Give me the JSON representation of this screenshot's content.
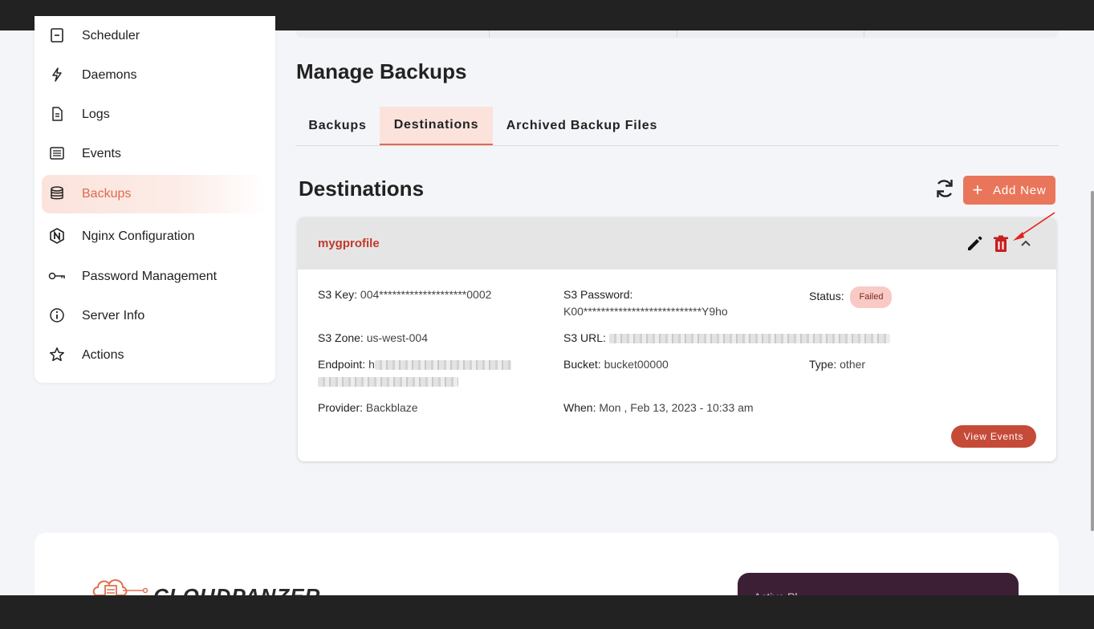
{
  "sidebar": {
    "items": [
      {
        "label": "Scheduler",
        "icon": "calendar-icon",
        "active": false
      },
      {
        "label": "Daemons",
        "icon": "bolt-icon",
        "active": false
      },
      {
        "label": "Logs",
        "icon": "document-icon",
        "active": false
      },
      {
        "label": "Events",
        "icon": "list-icon",
        "active": false
      },
      {
        "label": "Backups",
        "icon": "database-icon",
        "active": true
      },
      {
        "label": "Nginx Configuration",
        "icon": "nginx-icon",
        "active": false
      },
      {
        "label": "Password Management",
        "icon": "key-icon",
        "active": false
      },
      {
        "label": "Server Info",
        "icon": "info-icon",
        "active": false
      },
      {
        "label": "Actions",
        "icon": "star-icon",
        "active": false
      }
    ]
  },
  "main": {
    "title": "Manage Backups",
    "tabs": [
      {
        "label": "Backups",
        "active": false
      },
      {
        "label": "Destinations",
        "active": true
      },
      {
        "label": "Archived Backup Files",
        "active": false
      }
    ],
    "section_title": "Destinations",
    "add_button_label": "Add New",
    "accent_color": "#e9765a"
  },
  "destination": {
    "name": "mygprofile",
    "s3_key_label": "S3 Key:",
    "s3_key_value": "004********************0002",
    "s3_password_label": "S3 Password:",
    "s3_password_value": "K00***************************Y9ho",
    "status_label": "Status:",
    "status_value": "Failed",
    "s3_zone_label": "S3 Zone:",
    "s3_zone_value": "us-west-004",
    "s3_url_label": "S3 URL:",
    "endpoint_label": "Endpoint:",
    "endpoint_value_visible": "h",
    "bucket_label": "Bucket:",
    "bucket_value": "bucket00000",
    "type_label": "Type:",
    "type_value": "other",
    "provider_label": "Provider:",
    "provider_value": "Backblaze",
    "when_label": "When:",
    "when_value": "Mon , Feb 13, 2023 - 10:33 am",
    "view_events_label": "View Events"
  },
  "footer": {
    "brand": "CLOUDPANZER",
    "box_text": "Active Pl..."
  }
}
